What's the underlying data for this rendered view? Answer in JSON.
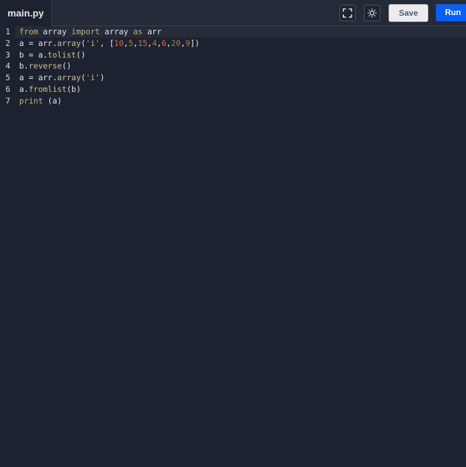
{
  "tab": {
    "label": "main.py"
  },
  "toolbar": {
    "fullscreen_icon": "fullscreen-icon",
    "theme_icon": "sun-icon",
    "save_label": "Save",
    "run_label": "Run"
  },
  "code": [
    [
      [
        "from",
        "kw"
      ],
      " array ",
      [
        "import",
        "kw"
      ],
      " array ",
      [
        "as",
        "kw"
      ],
      " arr"
    ],
    [
      "a = arr.",
      [
        "array",
        "fn"
      ],
      "(",
      [
        "'i'",
        "str"
      ],
      ", [",
      [
        "10",
        "num"
      ],
      ",",
      [
        "5",
        "num"
      ],
      ",",
      [
        "15",
        "num"
      ],
      ",",
      [
        "4",
        "num"
      ],
      ",",
      [
        "6",
        "num"
      ],
      ",",
      [
        "20",
        "num"
      ],
      ",",
      [
        "9",
        "num"
      ],
      "])"
    ],
    [
      "b = a.",
      [
        "tolist",
        "fn"
      ],
      "()"
    ],
    [
      "b.",
      [
        "reverse",
        "fn"
      ],
      "()"
    ],
    [
      "a = arr.",
      [
        "array",
        "fn"
      ],
      "(",
      [
        "'i'",
        "str"
      ],
      ")"
    ],
    [
      "a.",
      [
        "fromlist",
        "fn"
      ],
      "(b)"
    ],
    [
      [
        "print",
        "kw"
      ],
      " (a)"
    ]
  ]
}
